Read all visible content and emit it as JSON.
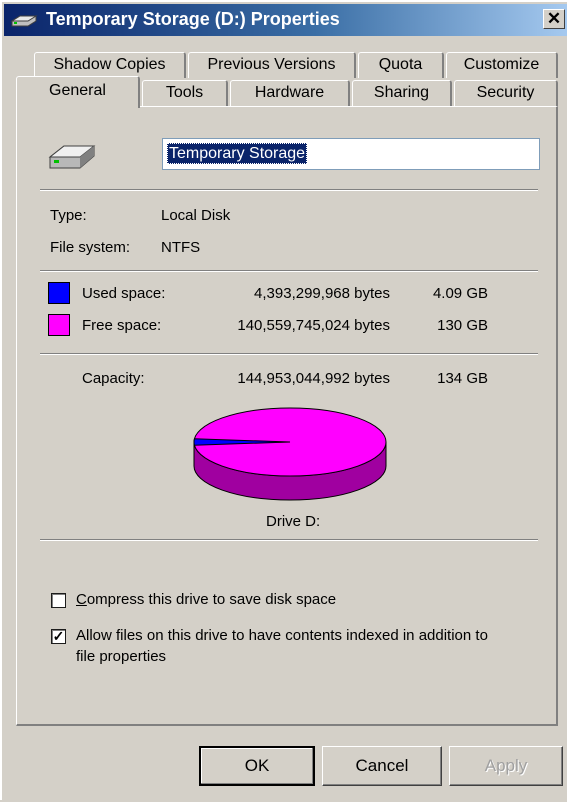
{
  "window": {
    "title": "Temporary Storage (D:) Properties",
    "close_label": "✕"
  },
  "tabs_back": [
    "Shadow Copies",
    "Previous Versions",
    "Quota",
    "Customize"
  ],
  "tabs_front": [
    "General",
    "Tools",
    "Hardware",
    "Sharing",
    "Security"
  ],
  "active_tab": "General",
  "general": {
    "drive_name": "Temporary Storage",
    "type_label": "Type:",
    "type_value": "Local Disk",
    "fs_label": "File system:",
    "fs_value": "NTFS",
    "used_label": "Used space:",
    "used_bytes": "4,393,299,968 bytes",
    "used_size": "4.09 GB",
    "free_label": "Free space:",
    "free_bytes": "140,559,745,024 bytes",
    "free_size": "130 GB",
    "capacity_label": "Capacity:",
    "capacity_bytes": "144,953,044,992 bytes",
    "capacity_size": "134 GB",
    "drive_label": "Drive D:",
    "used_fraction": 0.0303,
    "colors": {
      "used": "#0000ff",
      "free": "#ff00ff",
      "free_side": "#a000a0",
      "used_side": "#000090"
    }
  },
  "options": {
    "compress": {
      "label": "Compress this drive to save disk space",
      "checked": false
    },
    "index": {
      "label_line1": "Allow files on this drive to have contents indexed in addition to",
      "label_line2": "file properties",
      "checked": true
    }
  },
  "buttons": {
    "ok": "OK",
    "cancel": "Cancel",
    "apply": "Apply"
  }
}
